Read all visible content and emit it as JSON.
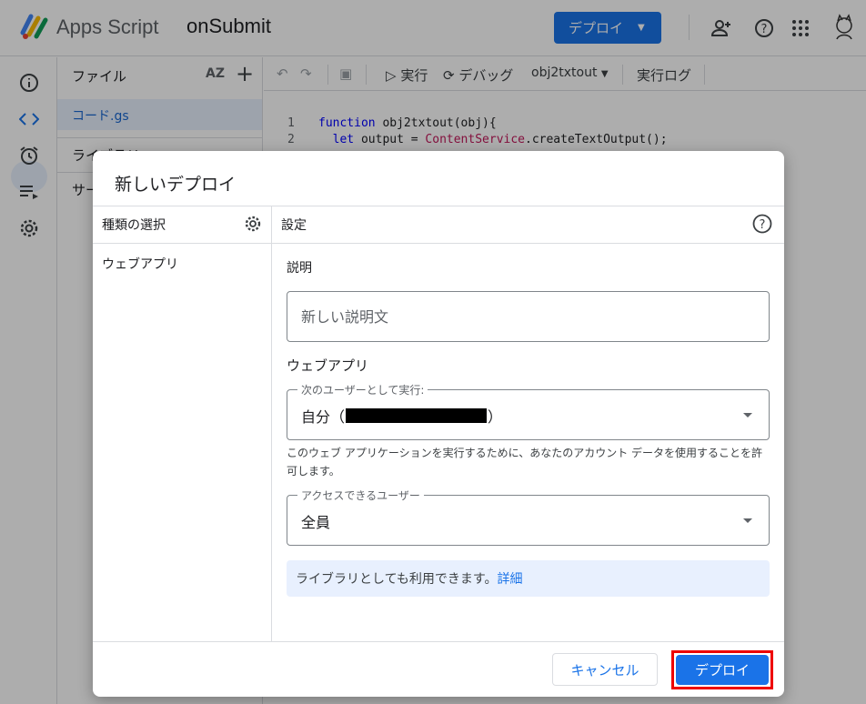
{
  "header": {
    "app_name": "Apps Script",
    "project_name": "onSubmit",
    "deploy_label": "デプロイ"
  },
  "file_panel": {
    "title": "ファイル",
    "sort_label": "AZ",
    "files": [
      "コード.gs"
    ],
    "sections": [
      "ライブラリ",
      "サービス"
    ]
  },
  "toolbar": {
    "run_label": "実行",
    "debug_label": "デバッグ",
    "function_name": "obj2txtout",
    "log_label": "実行ログ"
  },
  "editor": {
    "lines": [
      {
        "num": "1",
        "kw": "function",
        "rest": " obj2txtout(obj){"
      },
      {
        "num": "2",
        "kw": "  let",
        "rest": " output = ",
        "cls": "ContentService",
        "tail": ".createTextOutput();"
      }
    ]
  },
  "dialog": {
    "title": "新しいデプロイ",
    "type_column_header": "種類の選択",
    "types": [
      "ウェブアプリ"
    ],
    "settings_header": "設定",
    "description": {
      "label": "説明",
      "placeholder": "新しい説明文"
    },
    "webapp_section_label": "ウェブアプリ",
    "execute_as": {
      "label": "次のユーザーとして実行:",
      "value_prefix": "自分（",
      "value_suffix": "）"
    },
    "execute_helper": "このウェブ アプリケーションを実行するために、あなたのアカウント データを使用することを許可します。",
    "access": {
      "label": "アクセスできるユーザー",
      "value": "全員"
    },
    "info_text": "ライブラリとしても利用できます。",
    "info_link": "詳細",
    "cancel_label": "キャンセル",
    "deploy_label": "デプロイ"
  },
  "colors": {
    "primary": "#1a73e8",
    "highlight_border": "#ee0000",
    "info_bg": "#e8f0fe"
  }
}
